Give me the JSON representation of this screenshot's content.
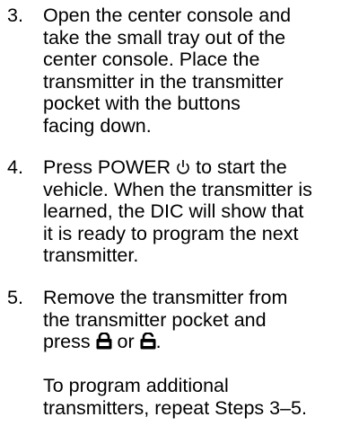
{
  "steps": [
    {
      "number": "3.",
      "lines": [
        "Open the center console and",
        "take the small tray out of the",
        "center console. Place the",
        "transmitter in the transmitter",
        "pocket with the buttons",
        "facing down."
      ]
    },
    {
      "number": "4.",
      "line1_before": "Press POWER ",
      "line1_icon": "power-icon",
      "line1_after": " to start the",
      "lines": [
        "vehicle. When the transmitter is",
        "learned, the DIC will show that",
        "it is ready to program the next",
        "transmitter."
      ]
    },
    {
      "number": "5.",
      "lines": [
        "Remove the transmitter from",
        "the transmitter pocket and"
      ],
      "last_before": "press ",
      "icon_a": "lock-icon",
      "between": " or ",
      "icon_b": "unlock-icon",
      "last_after": "."
    }
  ],
  "note": {
    "lines": [
      "To program additional",
      "transmitters, repeat Steps 3–5."
    ]
  }
}
